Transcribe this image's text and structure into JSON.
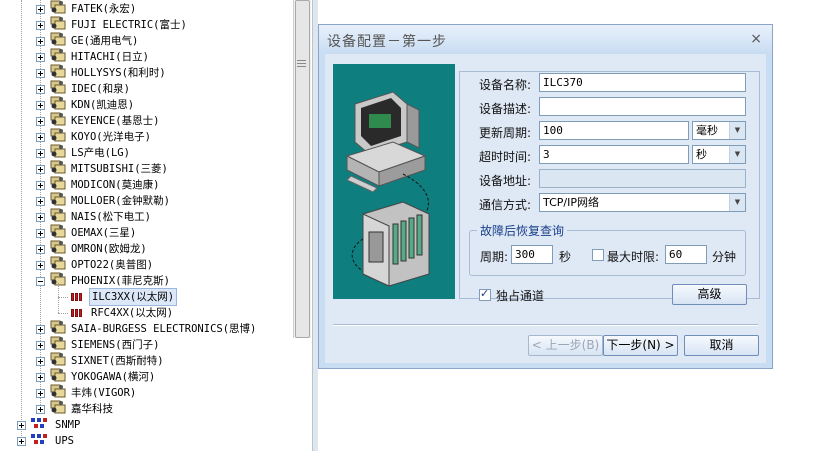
{
  "tree": {
    "vendors": [
      {
        "label": "FATEK(永宏)",
        "expanded": false
      },
      {
        "label": "FUJI ELECTRIC(富士)",
        "expanded": false
      },
      {
        "label": "GE(通用电气)",
        "expanded": false
      },
      {
        "label": "HITACHI(日立)",
        "expanded": false
      },
      {
        "label": "HOLLYSYS(和利时)",
        "expanded": false
      },
      {
        "label": "IDEC(和泉)",
        "expanded": false
      },
      {
        "label": "KDN(凯迪恩)",
        "expanded": false
      },
      {
        "label": "KEYENCE(基恩士)",
        "expanded": false
      },
      {
        "label": "KOYO(光洋电子)",
        "expanded": false
      },
      {
        "label": "LS产电(LG)",
        "expanded": false
      },
      {
        "label": "MITSUBISHI(三菱)",
        "expanded": false
      },
      {
        "label": "MODICON(莫迪康)",
        "expanded": false
      },
      {
        "label": "MOLLOER(金钟默勒)",
        "expanded": false
      },
      {
        "label": "NAIS(松下电工)",
        "expanded": false
      },
      {
        "label": "OEMAX(三星)",
        "expanded": false
      },
      {
        "label": "OMRON(欧姆龙)",
        "expanded": false
      },
      {
        "label": "OPTO22(奥普图)",
        "expanded": false
      },
      {
        "label": "PHOENIX(菲尼克斯)",
        "expanded": true
      },
      {
        "label": "SAIA-BURGESS ELECTRONICS(思博)",
        "expanded": false
      },
      {
        "label": "SIEMENS(西门子)",
        "expanded": false
      },
      {
        "label": "SIXNET(西斯耐特)",
        "expanded": false
      },
      {
        "label": "YOKOGAWA(横河)",
        "expanded": false
      },
      {
        "label": "丰炜(VIGOR)",
        "expanded": false
      },
      {
        "label": "嘉华科技",
        "expanded": false
      }
    ],
    "phoenix_children": [
      {
        "label": "ILC3XX(以太网)",
        "selected": true
      },
      {
        "label": "RFC4XX(以太网)",
        "selected": false
      }
    ],
    "groups": [
      {
        "label": "SNMP"
      },
      {
        "label": "UPS"
      }
    ]
  },
  "dialog": {
    "title": "设备配置－第一步",
    "close": "×",
    "fields": {
      "device_name_label": "设备名称:",
      "device_name_value": "ILC370",
      "device_desc_label": "设备描述:",
      "device_desc_value": "",
      "update_period_label": "更新周期:",
      "update_period_value": "100",
      "update_period_unit": "毫秒",
      "timeout_label": "超时时间:",
      "timeout_value": "3",
      "timeout_unit": "秒",
      "address_label": "设备地址:",
      "address_value": "",
      "comm_label": "通信方式:",
      "comm_value": "TCP/IP网络"
    },
    "recovery": {
      "legend": "故障后恢复查询",
      "period_label": "周期:",
      "period_value": "300",
      "period_unit": "秒",
      "max_limit_label": "最大时限:",
      "max_limit_checked": false,
      "max_limit_value": "60",
      "max_limit_unit": "分钟"
    },
    "exclusive_label": "独占通道",
    "exclusive_checked": true,
    "advanced_button": "高级",
    "prev_button": "< 上一步(B)",
    "next_button": "下一步(N) >",
    "cancel_button": "取消"
  }
}
